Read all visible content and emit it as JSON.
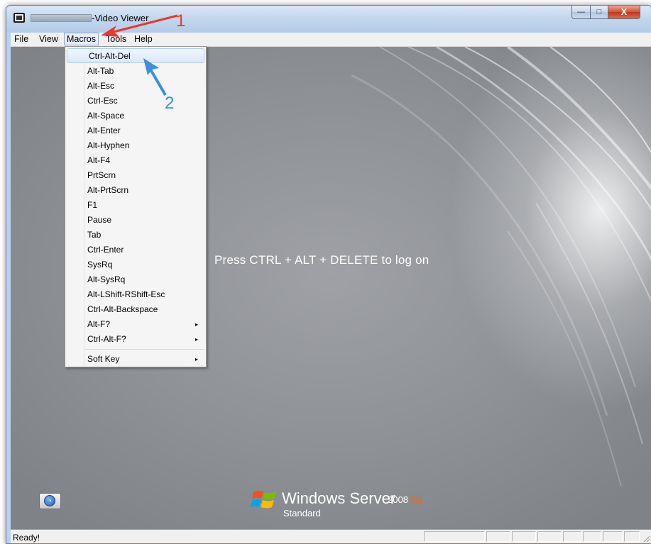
{
  "window": {
    "title": "-Video Viewer",
    "controls": {
      "minimize": "—",
      "maximize": "□",
      "close": "X"
    }
  },
  "menubar": {
    "items": [
      {
        "label": "File"
      },
      {
        "label": "View"
      },
      {
        "label": "Macros",
        "active": true
      },
      {
        "label": "Tools"
      },
      {
        "label": "Help"
      }
    ]
  },
  "macros_menu": {
    "items": [
      {
        "label": "Ctrl-Alt-Del",
        "highlighted": true
      },
      {
        "label": "Alt-Tab"
      },
      {
        "label": "Alt-Esc"
      },
      {
        "label": "Ctrl-Esc"
      },
      {
        "label": "Alt-Space"
      },
      {
        "label": "Alt-Enter"
      },
      {
        "label": "Alt-Hyphen"
      },
      {
        "label": "Alt-F4"
      },
      {
        "label": "PrtScrn"
      },
      {
        "label": "Alt-PrtScrn"
      },
      {
        "label": "F1"
      },
      {
        "label": "Pause"
      },
      {
        "label": "Tab"
      },
      {
        "label": "Ctrl-Enter"
      },
      {
        "label": "SysRq"
      },
      {
        "label": "Alt-SysRq"
      },
      {
        "label": "Alt-LShift-RShift-Esc"
      },
      {
        "label": "Ctrl-Alt-Backspace"
      },
      {
        "label": "Alt-F?",
        "submenu": true
      },
      {
        "label": "Ctrl-Alt-F?",
        "submenu": true
      },
      {
        "label": "Soft Key",
        "submenu": true
      }
    ],
    "submenu_arrow": "▸"
  },
  "remote_screen": {
    "logon_message": "Press CTRL + ALT + DELETE to log on",
    "brand": {
      "name": "Windows Server",
      "version": "2008",
      "release": "R2",
      "edition": "Standard"
    },
    "colors": {
      "background": "#8e9196",
      "text": "#ffffff",
      "r2_accent": "#e06a2c"
    }
  },
  "statusbar": {
    "text": "Ready!"
  },
  "annotations": {
    "arrow_1_label": "1",
    "arrow_2_label": "2",
    "arrow_1_color": "#e8392f",
    "arrow_2_color": "#3a8ee6"
  }
}
